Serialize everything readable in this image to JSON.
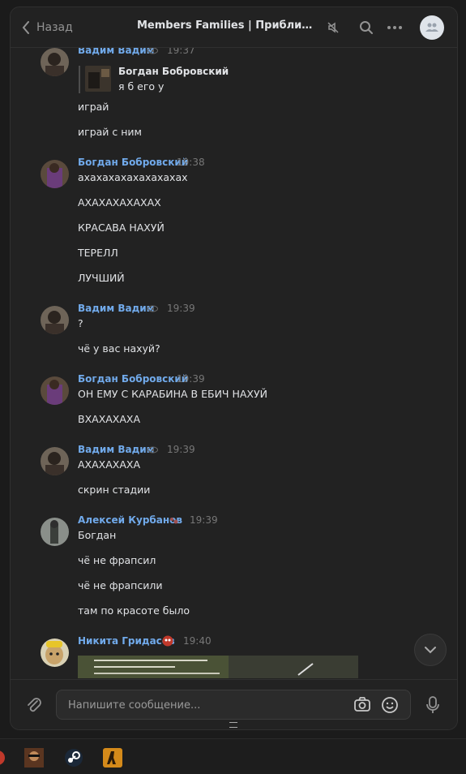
{
  "header": {
    "back_label": "Назад",
    "title": "Members Families | Приближённ..."
  },
  "messages": [
    {
      "author": "Вадим Вадим",
      "time": "19:37",
      "reply": {
        "author": "Богдан Бобровский",
        "text": "я б его у"
      },
      "lines": [
        "играй",
        "играй с ним"
      ]
    },
    {
      "author": "Богдан Бобровский",
      "time": "19:38",
      "lines": [
        "ахахахахахахахахах",
        "АХАХАХАХАХАХ",
        "КРАСАВА НАХУЙ",
        "ТЕРЕЛЛ",
        "ЛУЧШИЙ"
      ]
    },
    {
      "author": "Вадим Вадим",
      "time": "19:39",
      "lines": [
        "?",
        "чё у вас нахуй?"
      ]
    },
    {
      "author": "Богдан Бобровский",
      "time": "19:39",
      "lines": [
        "ОН ЕМУ С КАРАБИНА В ЕБИЧ НАХУЙ",
        "ВХАХАХАХА"
      ]
    },
    {
      "author": "Вадим Вадим",
      "time": "19:39",
      "lines": [
        "АХАХАХАХА",
        "скрин стадии"
      ]
    },
    {
      "author": "Алексей Курбанов",
      "time": "19:39",
      "lines": [
        "Богдан",
        "чё не фрапсил",
        "чё не фрапсили",
        "там по красоте было"
      ]
    },
    {
      "author": "Никита Гридасов",
      "time": "19:40",
      "lines": []
    }
  ],
  "composer": {
    "placeholder": "Напишите сообщение..."
  },
  "colors": {
    "accent_link": "#71aaeb",
    "background": "#222222",
    "text": "#e1e3e6"
  },
  "icons": [
    "chevron-left-icon",
    "mute-icon",
    "search-icon",
    "more-icon",
    "group-avatar-icon",
    "eye-icon",
    "chevron-down-icon",
    "attach-icon",
    "camera-icon",
    "smile-icon",
    "mic-icon"
  ]
}
